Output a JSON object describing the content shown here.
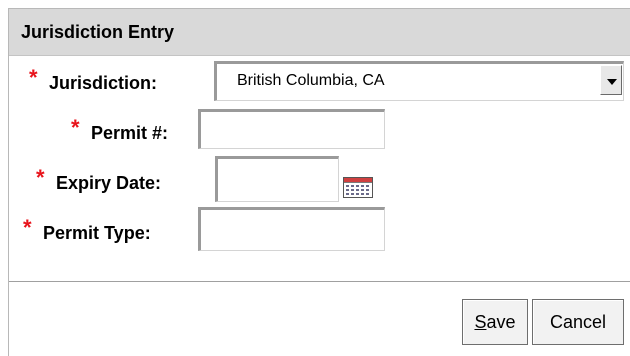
{
  "dialog": {
    "title": "Jurisdiction Entry"
  },
  "form": {
    "required_marker": "*",
    "jurisdiction": {
      "label": "Jurisdiction:",
      "value": "British Columbia, CA"
    },
    "permit_number": {
      "label": "Permit #:",
      "value": ""
    },
    "expiry_date": {
      "label": "Expiry Date:",
      "value": ""
    },
    "permit_type": {
      "label": "Permit Type:",
      "value": ""
    }
  },
  "icons": {
    "dropdown": "chevron-down-icon",
    "calendar": "calendar-icon"
  },
  "buttons": {
    "save_mnemonic": "S",
    "save_rest": "ave",
    "cancel_label": "Cancel"
  },
  "colors": {
    "required": "#e8141c",
    "titlebar": "#d9d9d9"
  }
}
